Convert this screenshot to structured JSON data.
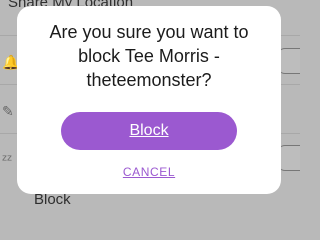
{
  "background": {
    "share_location_label": "Share My Location",
    "bottom_item_label": "Block"
  },
  "dialog": {
    "title": "Are you sure you want to block Tee Morris - theteemonster?",
    "primary_button_label": "Block",
    "cancel_label": "CANCEL"
  },
  "colors": {
    "accent": "#9b59d0",
    "overlay": "#b9b9b9",
    "dialog_background": "#ffffff"
  }
}
